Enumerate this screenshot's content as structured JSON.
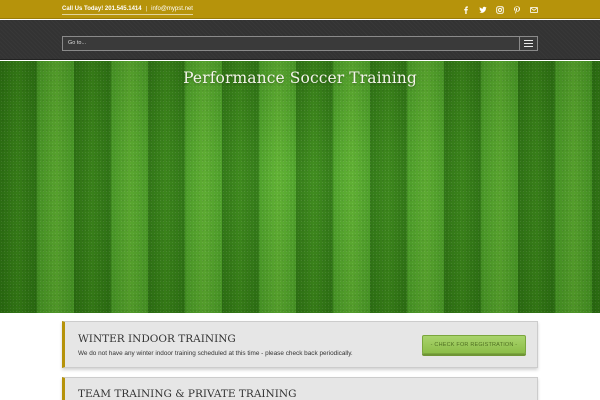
{
  "topbar": {
    "phone": "Call Us Today! 201.545.1414",
    "separator": "|",
    "email": "info@mypst.net",
    "social_icons": [
      "facebook-icon",
      "twitter-icon",
      "instagram-icon",
      "pinterest-icon",
      "mail-icon"
    ]
  },
  "nav": {
    "placeholder": "Go to..."
  },
  "hero": {
    "title": "Performance Soccer Training"
  },
  "sections": [
    {
      "heading": "WINTER INDOOR TRAINING",
      "description": "We do not have any winter indoor training scheduled at this time - please check back periodically.",
      "button_label": "- CHECK FOR REGISTRATION -"
    },
    {
      "heading": "TEAM TRAINING & PRIVATE TRAINING"
    }
  ],
  "colors": {
    "topbar": "#b6930b",
    "navbar": "#333333",
    "button": "#8cbd49",
    "box_background": "#e6e6e6"
  }
}
